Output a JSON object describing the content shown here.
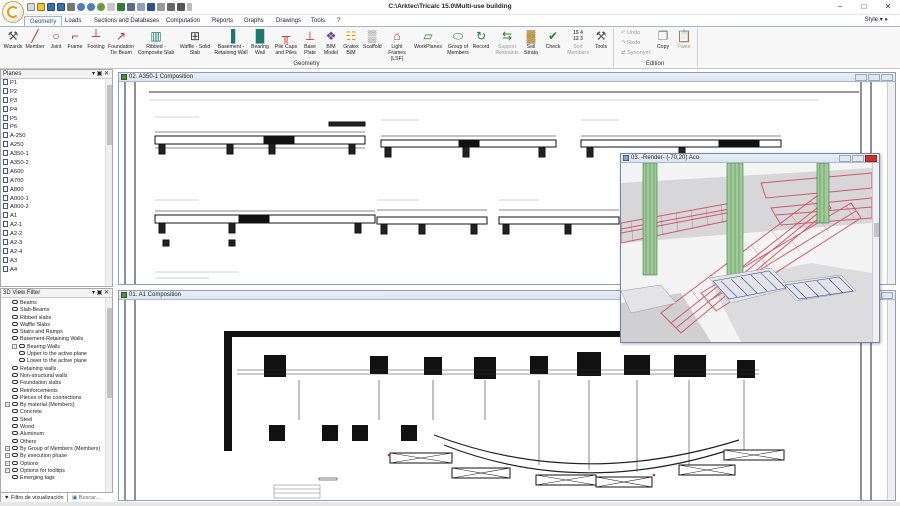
{
  "app": {
    "title": "C:\\Arktec\\Tricalc 15.0\\Multi-use building",
    "style_label": "Style",
    "window_controls": [
      "–",
      "□",
      "✕"
    ]
  },
  "tabs": [
    {
      "label": "Geometry",
      "active": true
    },
    {
      "label": "Loads"
    },
    {
      "label": "Sections and Databases"
    },
    {
      "label": "Computation"
    },
    {
      "label": "Reports"
    },
    {
      "label": "Graphs"
    },
    {
      "label": "Drawings"
    },
    {
      "label": "Tools"
    },
    {
      "label": "?"
    }
  ],
  "ribbon": {
    "buttons": [
      {
        "label": "Wizards",
        "icon": "wizard-icon",
        "glyph": "⚒",
        "color": "#555555"
      },
      {
        "label": "Member",
        "icon": "member-icon",
        "glyph": "╱",
        "color": "#c62828"
      },
      {
        "label": "Joint",
        "icon": "joint-icon",
        "glyph": "○",
        "color": "#c62828"
      },
      {
        "label": "Frame",
        "icon": "frame-icon",
        "glyph": "⌐",
        "color": "#c62828"
      },
      {
        "label": "Footing",
        "icon": "footing-icon",
        "glyph": "┴",
        "color": "#c62828"
      },
      {
        "label": "Foundation Tie Beam",
        "icon": "tie-beam-icon",
        "glyph": "↗",
        "color": "#c62828"
      },
      {
        "label": "Ribbed - Composite Slab",
        "icon": "ribbed-slab-icon",
        "glyph": "▥",
        "color": "#1b7a6e"
      },
      {
        "label": "Waffle - Solid Slab",
        "icon": "waffle-slab-icon",
        "glyph": "⊞",
        "color": "#333333"
      },
      {
        "label": "Basement - Retaining Wall",
        "icon": "retaining-wall-icon",
        "glyph": "▐",
        "color": "#1b7a6e"
      },
      {
        "label": "Bearing Wall",
        "icon": "bearing-wall-icon",
        "glyph": "█",
        "color": "#1b7a6e"
      },
      {
        "label": "Pile Caps and Piles",
        "icon": "pile-caps-icon",
        "glyph": "╥",
        "color": "#c62828"
      },
      {
        "label": "Base Plate",
        "icon": "base-plate-icon",
        "glyph": "⊥",
        "color": "#c62828"
      },
      {
        "label": "BIM Model",
        "icon": "bim-model-icon",
        "glyph": "❖",
        "color": "#6a3fa0"
      },
      {
        "label": "Gratex BIM",
        "icon": "gratex-icon",
        "glyph": "☷",
        "color": "#e0a000"
      },
      {
        "label": "Scaffold",
        "icon": "scaffold-icon",
        "glyph": "▒",
        "color": "#555555"
      },
      {
        "label": "Light Frames (LSF)",
        "icon": "light-frames-icon",
        "glyph": "⌂",
        "color": "#c62828"
      },
      {
        "label": "WorkPlanes",
        "icon": "workplanes-icon",
        "glyph": "▱",
        "color": "#2e7d32"
      },
      {
        "label": "Group of Members",
        "icon": "group-members-icon",
        "glyph": "⬭",
        "color": "#2e7d32"
      },
      {
        "label": "Record",
        "icon": "record-icon",
        "glyph": "↻",
        "color": "#2e7d32"
      },
      {
        "label": "Support Restraints",
        "icon": "support-restraints-icon",
        "glyph": "⇆",
        "color": "#2e7d32",
        "disabled": true
      },
      {
        "label": "Soil Strata",
        "icon": "soil-strata-icon",
        "glyph": "▓",
        "color": "#b0842a"
      },
      {
        "label": "Check",
        "icon": "check-icon",
        "glyph": "✔",
        "color": "#2e7d32"
      },
      {
        "label": "Sort Members",
        "icon": "sort-members-icon",
        "glyph": "15 4\n12 3",
        "color": "#555555",
        "disabled": true
      },
      {
        "label": "Tools",
        "icon": "tools-icon",
        "glyph": "⚒",
        "color": "#555555"
      }
    ],
    "edit_items": [
      "Undo",
      "Redo",
      "Synonym"
    ],
    "copy_label": "Copy",
    "paste_label": "Paste",
    "group_geometry": "Geometry",
    "group_edition": "Edition"
  },
  "planes_panel": {
    "title": "Planes",
    "items": [
      "P1",
      "P2",
      "P3",
      "P4",
      "P5",
      "P6",
      "A-250",
      "A250",
      "A350-1",
      "A350-2",
      "A600",
      "A700",
      "A800",
      "A000-1",
      "A000-2",
      "A1",
      "A2-1",
      "A2-2",
      "A2-3",
      "A2-4",
      "A3",
      "A4"
    ]
  },
  "filter_panel": {
    "title": "3D View Filter",
    "items": [
      {
        "label": "Beams",
        "level": 2
      },
      {
        "label": "Slab-Beams",
        "level": 2
      },
      {
        "label": "Ribbed slabs",
        "level": 2
      },
      {
        "label": "Waffle Slabs",
        "level": 2
      },
      {
        "label": "Stairs and Ramps",
        "level": 2
      },
      {
        "label": "Basement-Retaining Walls",
        "level": 2
      },
      {
        "label": "Bearing Walls",
        "level": 2,
        "expand": true
      },
      {
        "label": "Upper to the active plane",
        "level": 3
      },
      {
        "label": "Lower to the active plane",
        "level": 3
      },
      {
        "label": "Retaining walls",
        "level": 2
      },
      {
        "label": "Non-structural walls",
        "level": 2
      },
      {
        "label": "Foundation slabs",
        "level": 2
      },
      {
        "label": "Reinforcements",
        "level": 2
      },
      {
        "label": "Pieces of the connections",
        "level": 2
      },
      {
        "label": "By material (Members)",
        "level": 1,
        "expand": true
      },
      {
        "label": "Concrete",
        "level": 2
      },
      {
        "label": "Steel",
        "level": 2
      },
      {
        "label": "Wood",
        "level": 2
      },
      {
        "label": "Aluminum",
        "level": 2
      },
      {
        "label": "Others",
        "level": 2
      },
      {
        "label": "By Group of Members (Members)",
        "level": 1,
        "expand": true
      },
      {
        "label": "By execution phase",
        "level": 1,
        "expand": true
      },
      {
        "label": "Options",
        "level": 1,
        "expand": true
      },
      {
        "label": "Options for tooltips",
        "level": 1,
        "expand": true
      },
      {
        "label": "Emerging tags",
        "level": 2
      }
    ],
    "bottom_tabs": [
      "Filtro de visualización",
      "Buscar..."
    ]
  },
  "windows": {
    "top": {
      "title": "02. A350-1 Composition"
    },
    "bottom": {
      "title": "01. A1 Composition"
    },
    "render": {
      "title": "03. -Render-  (-70,20)  Aco"
    }
  }
}
